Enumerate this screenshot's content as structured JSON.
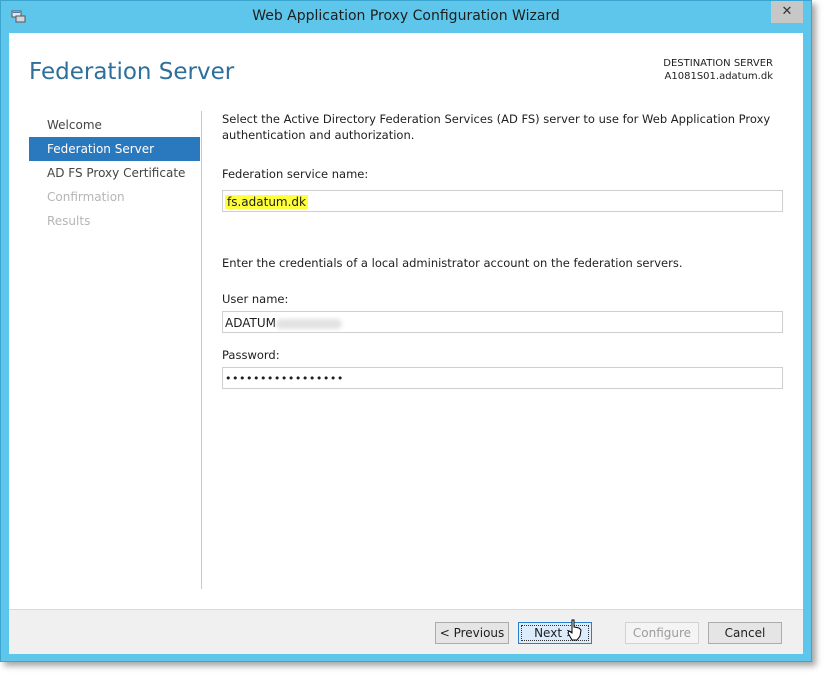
{
  "window": {
    "title": "Web Application Proxy Configuration Wizard",
    "close_glyph": "✕"
  },
  "header": {
    "page_title": "Federation Server",
    "destination_label": "DESTINATION SERVER",
    "destination_server": "A1081S01.adatum.dk"
  },
  "nav": {
    "items": [
      {
        "label": "Welcome",
        "state": "normal"
      },
      {
        "label": "Federation Server",
        "state": "active"
      },
      {
        "label": "AD FS Proxy Certificate",
        "state": "normal"
      },
      {
        "label": "Confirmation",
        "state": "disabled"
      },
      {
        "label": "Results",
        "state": "disabled"
      }
    ]
  },
  "main": {
    "description": "Select the Active Directory Federation Services (AD FS) server to use for Web Application Proxy authentication and authorization.",
    "federation_label": "Federation service name:",
    "federation_value": "fs.adatum.dk",
    "credentials_text": "Enter the credentials of a local administrator account on the federation servers.",
    "username_label": "User name:",
    "username_value": "ADATUM",
    "password_label": "Password:",
    "password_value": "•••••••••••••••••"
  },
  "footer": {
    "previous_label": "< Previous",
    "next_label": "Next >",
    "configure_label": "Configure",
    "cancel_label": "Cancel"
  },
  "colors": {
    "accent": "#2a78bd",
    "title_bar": "#5ec6ea",
    "highlight": "#ffff3a"
  },
  "icons": [
    "app-icon",
    "close-icon",
    "mouse-cursor-icon"
  ]
}
